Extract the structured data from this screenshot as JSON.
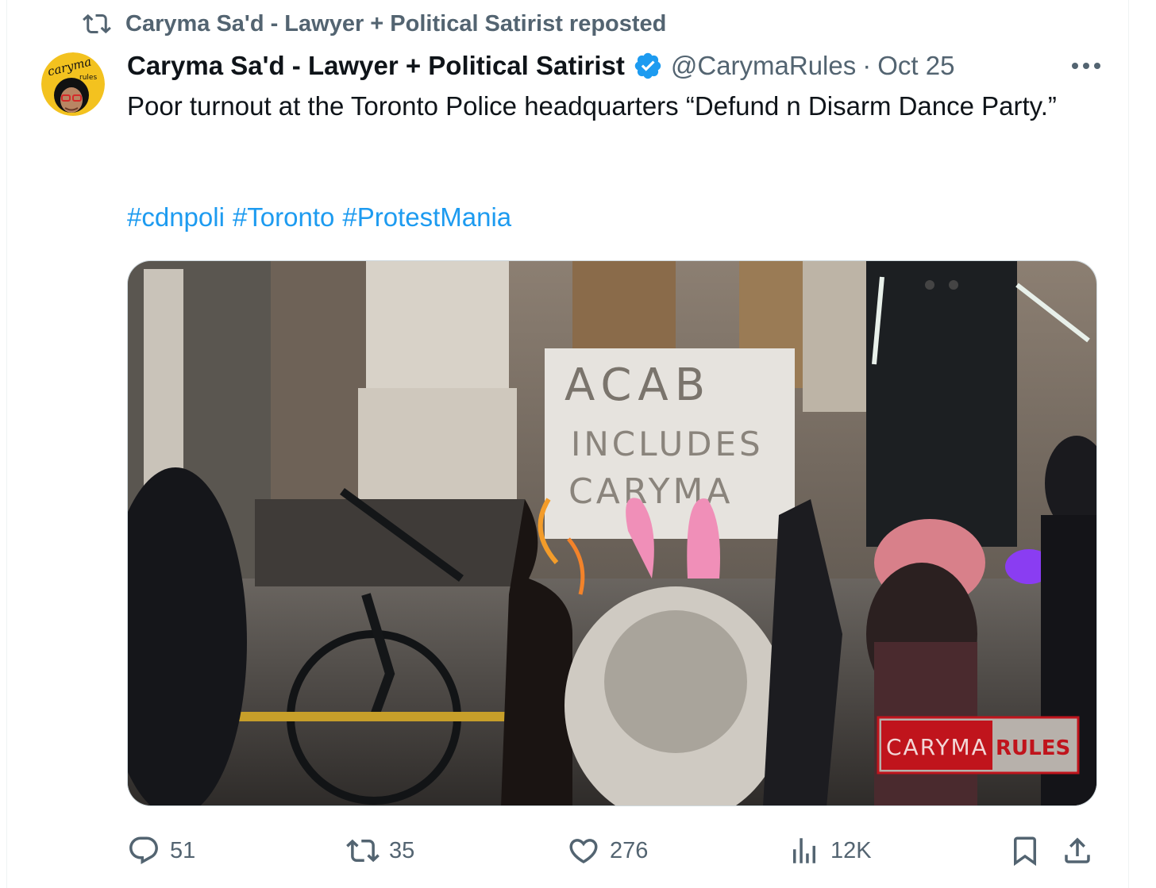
{
  "repost": {
    "label": "Caryma Sa'd - Lawyer + Political Satirist reposted"
  },
  "tweet": {
    "author_name": "Caryma Sa'd - Lawyer + Political Satirist",
    "handle": "@CarymaRules",
    "separator": "·",
    "date": "Oct 25",
    "text": "Poor turnout at the Toronto Police headquarters “Defund n Disarm Dance Party.”",
    "hashtags": [
      "#cdnpoli",
      "#Toronto",
      "#ProtestMania"
    ]
  },
  "avatar": {
    "logo_text_top": "caryma",
    "logo_text_small": "rules"
  },
  "media": {
    "sign_text_line1": "ACAB",
    "sign_text_line2": "INCLUDES",
    "sign_text_line3": "CARYMA",
    "watermark_left": "CARYMA",
    "watermark_right": "RULES"
  },
  "actions": {
    "replies": "51",
    "reposts": "35",
    "likes": "276",
    "views": "12K"
  },
  "colors": {
    "accent": "#1d9bf0",
    "muted": "#536471",
    "watermark_red": "#c0141c"
  }
}
